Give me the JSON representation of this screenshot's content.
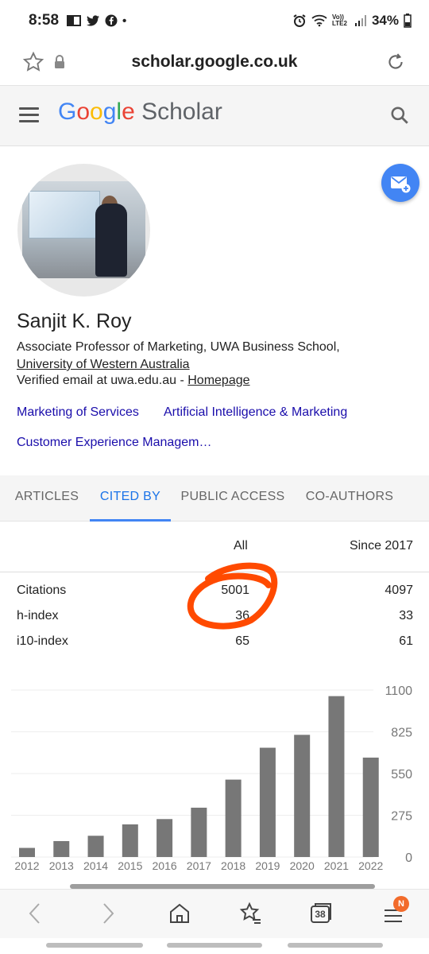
{
  "status": {
    "time": "8:58",
    "battery": "34%",
    "lte": "Vo)) LTE2"
  },
  "browser": {
    "url": "scholar.google.co.uk",
    "tab_count": "38",
    "menu_badge": "N"
  },
  "header": {
    "logo_google": "Google",
    "logo_scholar": "Scholar"
  },
  "profile": {
    "name": "Sanjit K. Roy",
    "affiliation": "Associate Professor of Marketing, UWA Business School,",
    "university": "University of Western Australia",
    "verified": "Verified email at uwa.edu.au - ",
    "homepage": "Homepage",
    "interests": [
      "Marketing of Services",
      "Artificial Intelligence & Marketing",
      "Customer Experience Managem…"
    ]
  },
  "tabs": [
    "ARTICLES",
    "CITED BY",
    "PUBLIC ACCESS",
    "CO-AUTHORS"
  ],
  "stats": {
    "col_all": "All",
    "col_since": "Since 2017",
    "rows": [
      {
        "label": "Citations",
        "all": "5001",
        "since": "4097"
      },
      {
        "label": "h-index",
        "all": "36",
        "since": "33"
      },
      {
        "label": "i10-index",
        "all": "65",
        "since": "61"
      }
    ]
  },
  "colors": {
    "bar": "#777777",
    "scribble": "#ff4a00",
    "tab_active": "#1a73e8"
  },
  "chart_data": {
    "type": "bar",
    "categories": [
      "2012",
      "2013",
      "2014",
      "2015",
      "2016",
      "2017",
      "2018",
      "2019",
      "2020",
      "2021",
      "2022"
    ],
    "values": [
      60,
      105,
      140,
      215,
      250,
      325,
      510,
      720,
      805,
      1060,
      655
    ],
    "y_ticks": [
      "1100",
      "825",
      "550",
      "275",
      "0"
    ],
    "ylim": [
      0,
      1100
    ],
    "grid": true
  }
}
